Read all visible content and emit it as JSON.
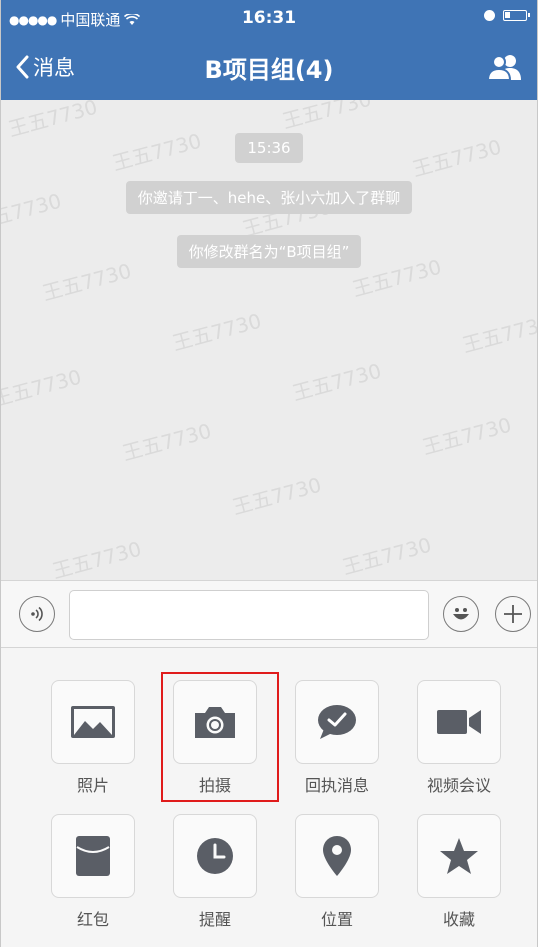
{
  "status_bar": {
    "carrier": "中国联通",
    "time": "16:31"
  },
  "nav": {
    "back_label": "消息",
    "title": "B项目组(4)"
  },
  "chat": {
    "messages": [
      "15:36",
      "你邀请丁一、hehe、张小六加入了群聊",
      "你修改群名为“B项目组”"
    ],
    "watermark": "王五7730"
  },
  "panel": {
    "items": [
      {
        "label": "照片",
        "icon": "photo-icon"
      },
      {
        "label": "拍摄",
        "icon": "camera-icon"
      },
      {
        "label": "回执消息",
        "icon": "receipt-message-icon"
      },
      {
        "label": "视频会议",
        "icon": "video-call-icon"
      },
      {
        "label": "红包",
        "icon": "red-packet-icon"
      },
      {
        "label": "提醒",
        "icon": "clock-icon"
      },
      {
        "label": "位置",
        "icon": "location-pin-icon"
      },
      {
        "label": "收藏",
        "icon": "star-icon"
      }
    ]
  },
  "colors": {
    "nav_bg": "#3f74b5",
    "icon_gray": "#5a5e66",
    "highlight": "#e01b1b"
  }
}
